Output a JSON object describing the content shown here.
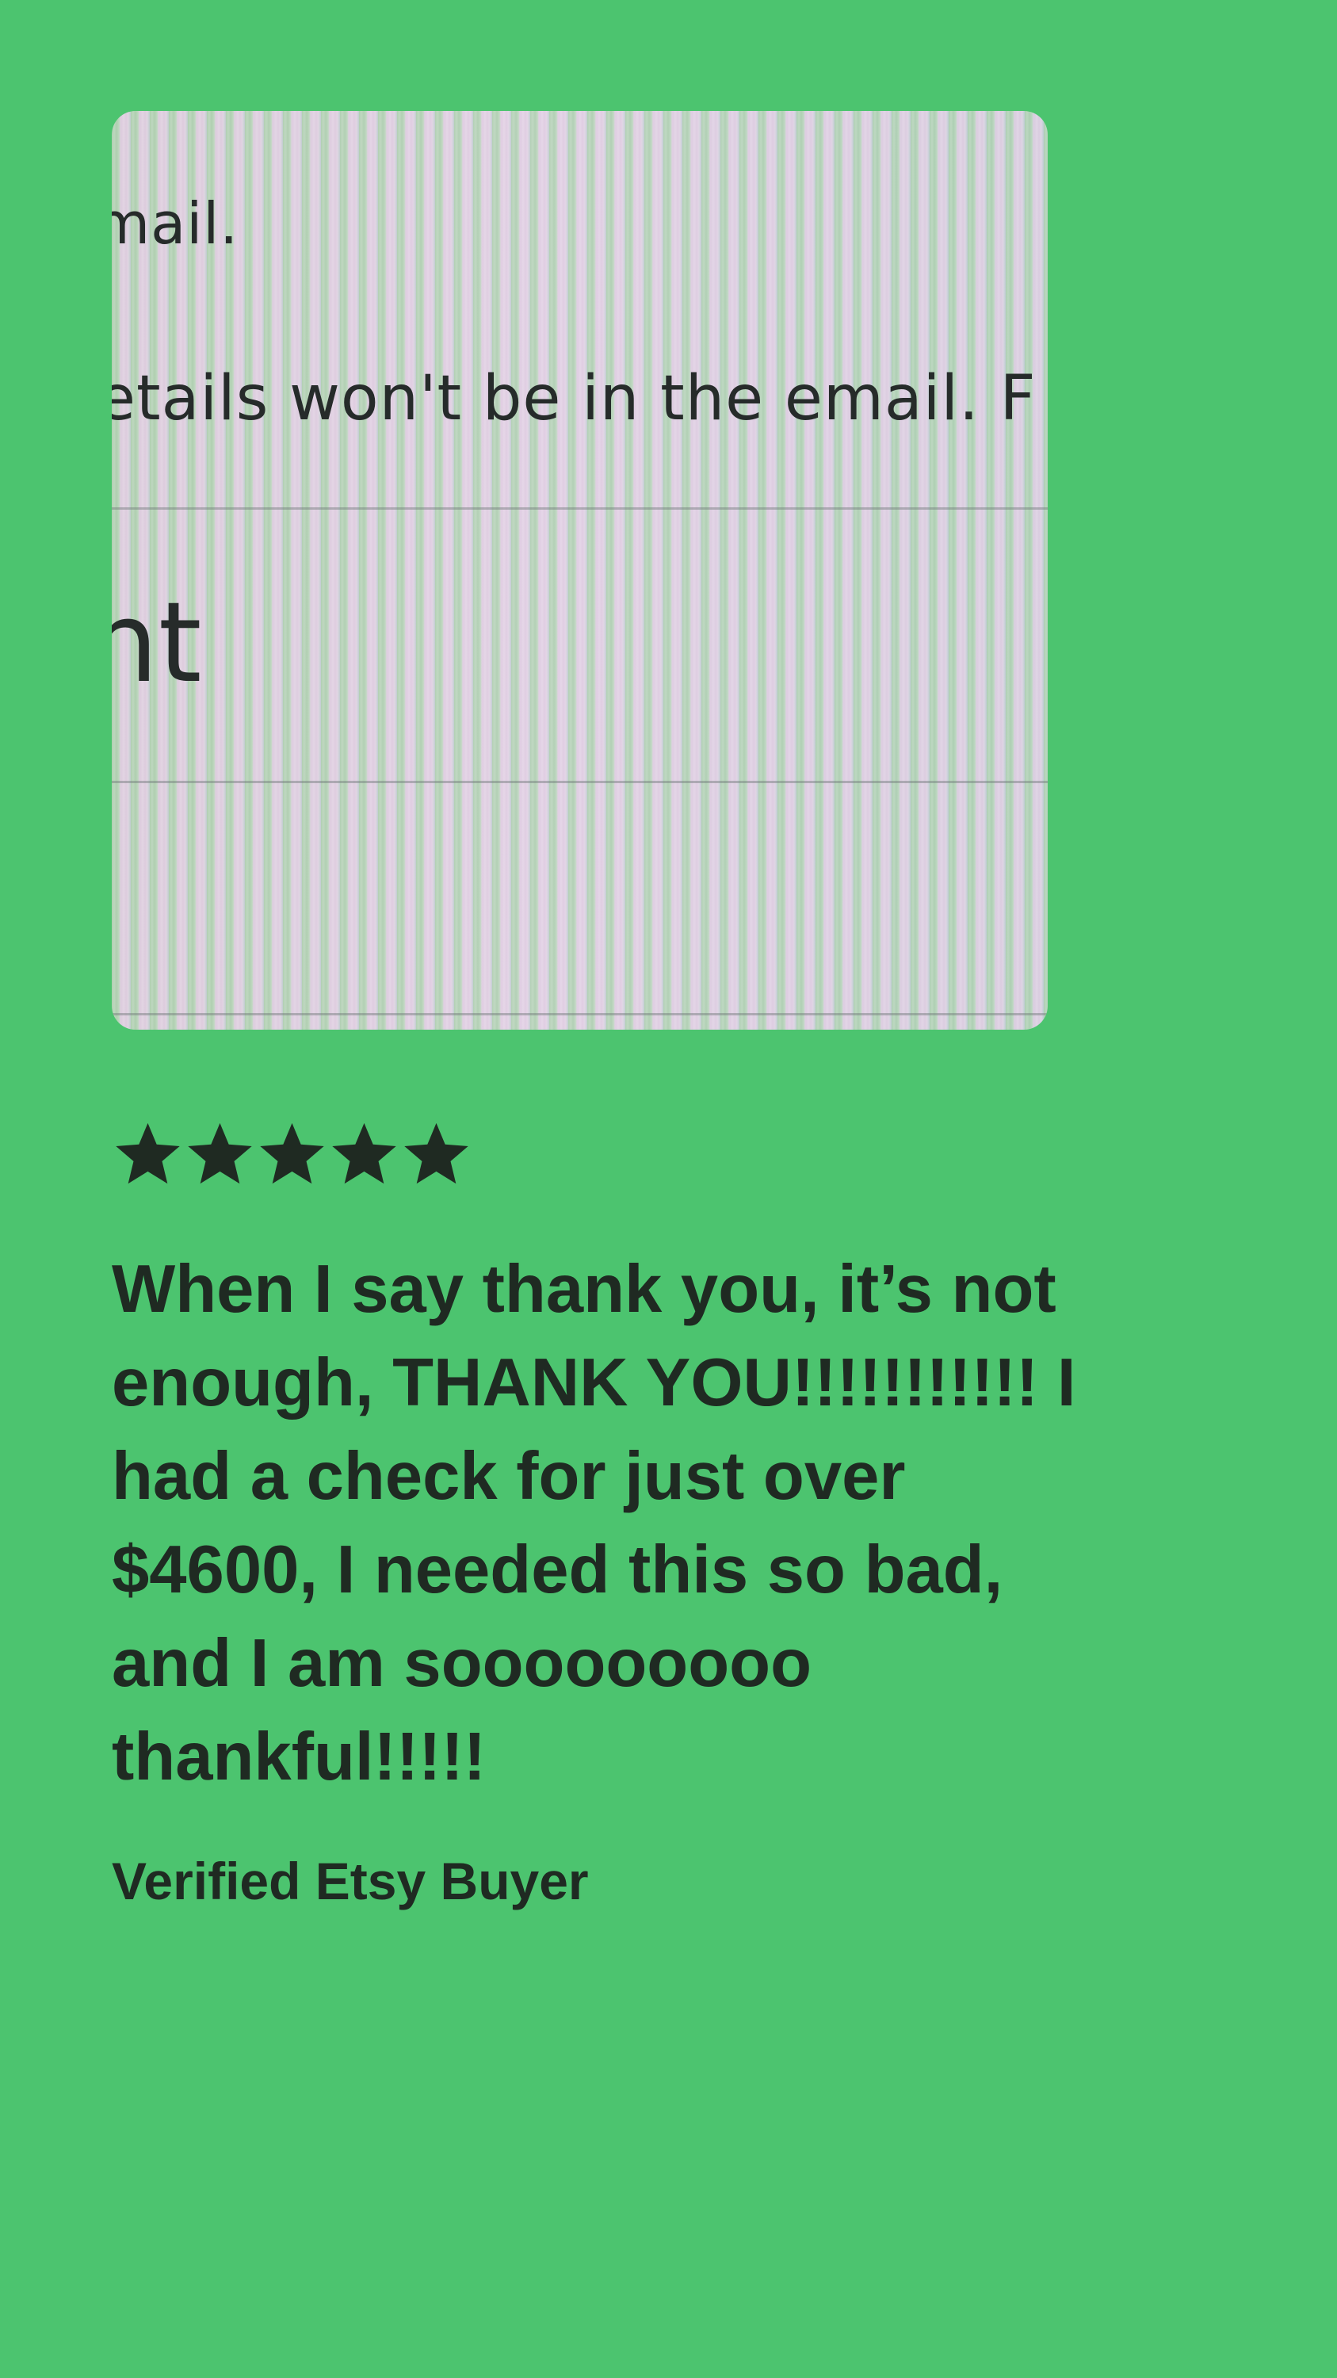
{
  "photo": {
    "line_1": "mail.",
    "line_2": "etails won't be in the email. F",
    "line_3": "nt"
  },
  "rating": {
    "stars": 5,
    "max": 5,
    "icon": "star-icon"
  },
  "review": {
    "text_line_1": "When I say thank you, it’s not",
    "text_line_2": "enough, THANK YOU!!!!!!!!!!! I",
    "text_line_3": "had a check for just over",
    "text_line_4": "$4600, I needed this so bad,",
    "text_line_5": "and I am sooooooooo",
    "text_line_6": "thankful!!!!!"
  },
  "buyer_label": "Verified Etsy Buyer",
  "colors": {
    "background": "#4cc46f",
    "text": "#1f2a22"
  }
}
